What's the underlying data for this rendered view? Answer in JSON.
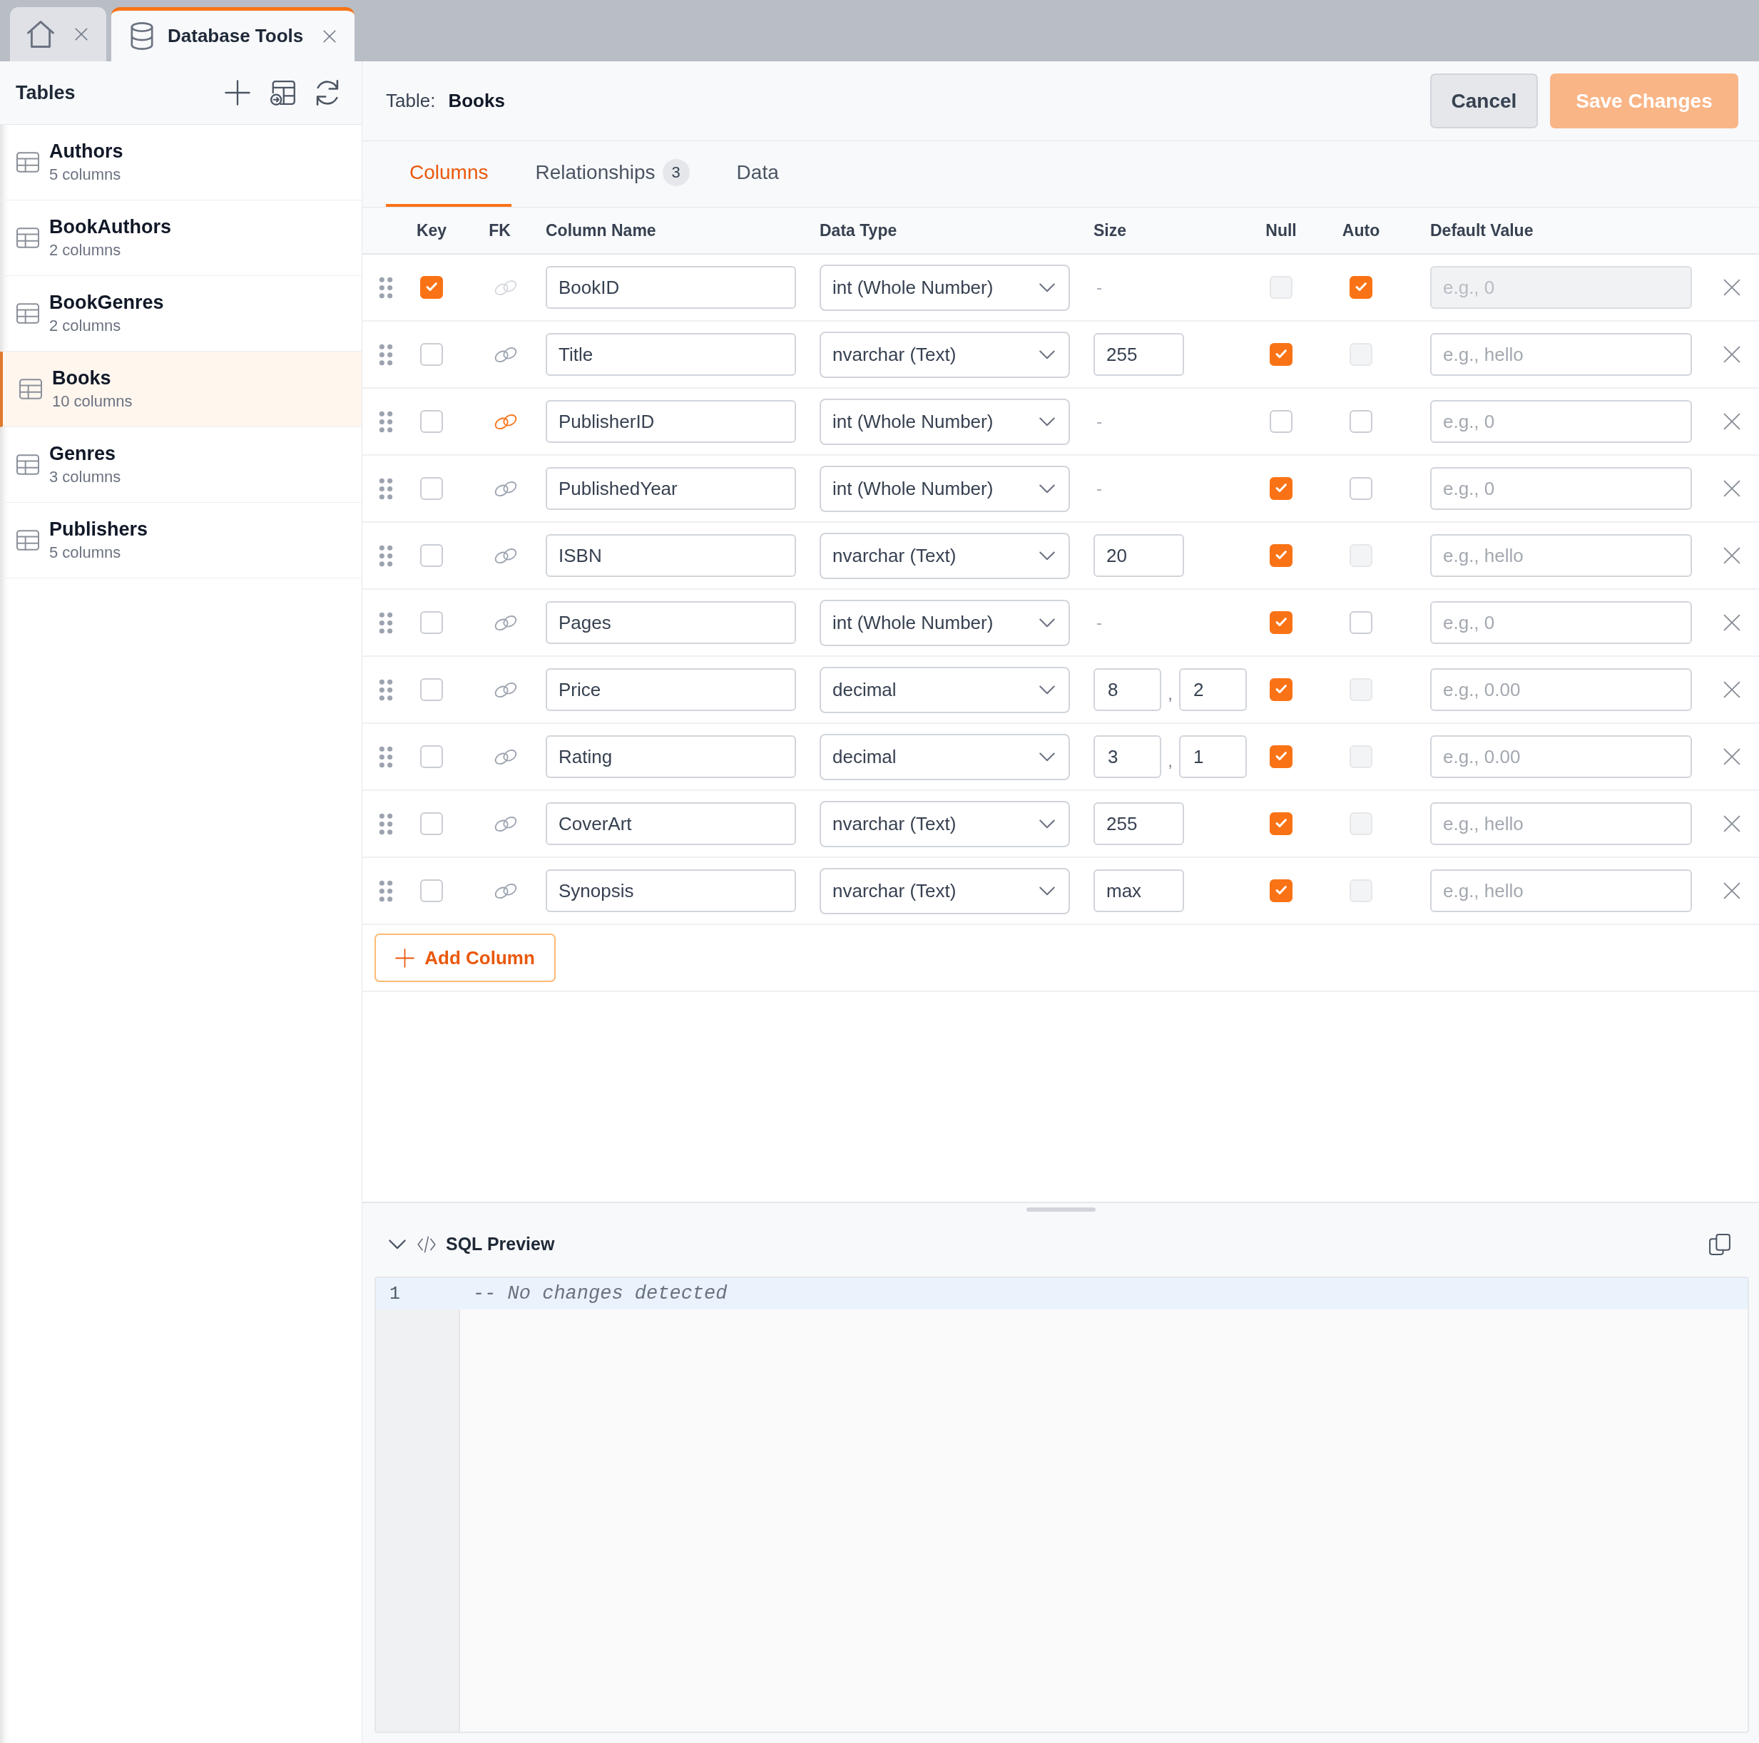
{
  "tabs": [
    {
      "kind": "home",
      "selected": false
    },
    {
      "kind": "database",
      "label": "Database Tools",
      "selected": true
    }
  ],
  "sidebar": {
    "title": "Tables",
    "tables": [
      {
        "name": "Authors",
        "detail": "5 columns",
        "selected": false
      },
      {
        "name": "BookAuthors",
        "detail": "2 columns",
        "selected": false
      },
      {
        "name": "BookGenres",
        "detail": "2 columns",
        "selected": false
      },
      {
        "name": "Books",
        "detail": "10 columns",
        "selected": true
      },
      {
        "name": "Genres",
        "detail": "3 columns",
        "selected": false
      },
      {
        "name": "Publishers",
        "detail": "5 columns",
        "selected": false
      }
    ]
  },
  "header": {
    "label": "Table:",
    "table_name": "Books",
    "buttons": [
      {
        "label": "Cancel",
        "kind": "secondary",
        "disabled": false
      },
      {
        "label": "Save Changes",
        "kind": "primary",
        "disabled": true
      }
    ]
  },
  "editor_tabs": [
    {
      "label": "Columns",
      "selected": true
    },
    {
      "label": "Relationships",
      "badge": "3",
      "selected": false
    },
    {
      "label": "Data",
      "selected": false
    }
  ],
  "table": {
    "columns": [
      "Key",
      "FK",
      "Column Name",
      "Data Type",
      "Size",
      "Null",
      "Auto",
      "Default Value"
    ],
    "rows": [
      {
        "key": true,
        "fk": false,
        "fk_disabled": true,
        "name": "BookID",
        "data_type": "int (Whole Number)",
        "size": {
          "kind": "none",
          "text": "-"
        },
        "null": false,
        "null_disabled": true,
        "auto": true,
        "auto_disabled": false,
        "default_placeholder": "e.g., 0",
        "default_disabled": true
      },
      {
        "key": false,
        "fk": false,
        "fk_disabled": false,
        "name": "Title",
        "data_type": "nvarchar (Text)",
        "size": {
          "kind": "length",
          "values": [
            "255"
          ]
        },
        "null": true,
        "null_disabled": false,
        "auto": false,
        "auto_disabled": true,
        "default_placeholder": "e.g., hello",
        "default_disabled": false
      },
      {
        "key": false,
        "fk": true,
        "fk_disabled": false,
        "name": "PublisherID",
        "data_type": "int (Whole Number)",
        "size": {
          "kind": "none",
          "text": "-"
        },
        "null": false,
        "null_disabled": false,
        "auto": false,
        "auto_disabled": false,
        "default_placeholder": "e.g., 0",
        "default_disabled": false
      },
      {
        "key": false,
        "fk": false,
        "fk_disabled": false,
        "name": "PublishedYear",
        "data_type": "int (Whole Number)",
        "size": {
          "kind": "none",
          "text": "-"
        },
        "null": true,
        "null_disabled": false,
        "auto": false,
        "auto_disabled": false,
        "default_placeholder": "e.g., 0",
        "default_disabled": false
      },
      {
        "key": false,
        "fk": false,
        "fk_disabled": false,
        "name": "ISBN",
        "data_type": "nvarchar (Text)",
        "size": {
          "kind": "length",
          "values": [
            "20"
          ]
        },
        "null": true,
        "null_disabled": false,
        "auto": false,
        "auto_disabled": true,
        "default_placeholder": "e.g., hello",
        "default_disabled": false
      },
      {
        "key": false,
        "fk": false,
        "fk_disabled": false,
        "name": "Pages",
        "data_type": "int (Whole Number)",
        "size": {
          "kind": "none",
          "text": "-"
        },
        "null": true,
        "null_disabled": false,
        "auto": false,
        "auto_disabled": false,
        "default_placeholder": "e.g., 0",
        "default_disabled": false
      },
      {
        "key": false,
        "fk": false,
        "fk_disabled": false,
        "name": "Price",
        "data_type": "decimal",
        "size": {
          "kind": "precision",
          "values": [
            "8",
            "2"
          ],
          "separator": ","
        },
        "null": true,
        "null_disabled": false,
        "auto": false,
        "auto_disabled": true,
        "default_placeholder": "e.g., 0.00",
        "default_disabled": false
      },
      {
        "key": false,
        "fk": false,
        "fk_disabled": false,
        "name": "Rating",
        "data_type": "decimal",
        "size": {
          "kind": "precision",
          "values": [
            "3",
            "1"
          ],
          "separator": ","
        },
        "null": true,
        "null_disabled": false,
        "auto": false,
        "auto_disabled": true,
        "default_placeholder": "e.g., 0.00",
        "default_disabled": false
      },
      {
        "key": false,
        "fk": false,
        "fk_disabled": false,
        "name": "CoverArt",
        "data_type": "nvarchar (Text)",
        "size": {
          "kind": "length",
          "values": [
            "255"
          ]
        },
        "null": true,
        "null_disabled": false,
        "auto": false,
        "auto_disabled": true,
        "default_placeholder": "e.g., hello",
        "default_disabled": false
      },
      {
        "key": false,
        "fk": false,
        "fk_disabled": false,
        "name": "Synopsis",
        "data_type": "nvarchar (Text)",
        "size": {
          "kind": "length",
          "values": [
            "max"
          ]
        },
        "null": true,
        "null_disabled": false,
        "auto": false,
        "auto_disabled": true,
        "default_placeholder": "e.g., hello",
        "default_disabled": false
      }
    ]
  },
  "add_button": {
    "label": "Add Column"
  },
  "sql_preview": {
    "title": "SQL Preview",
    "expanded": true,
    "lines": [
      {
        "number": "1",
        "text": "-- No changes detected",
        "active": true
      }
    ]
  }
}
